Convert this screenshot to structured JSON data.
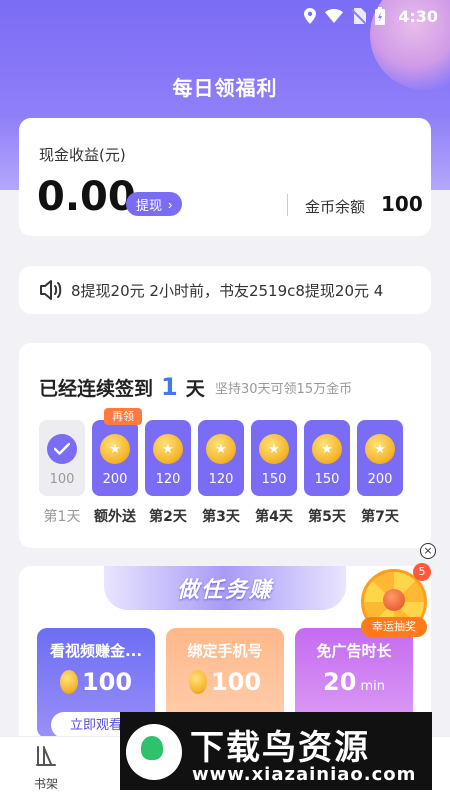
{
  "status_bar": {
    "time": "4:30"
  },
  "page": {
    "title": "每日领福利"
  },
  "earnings": {
    "label": "现金收益(元)",
    "value": "0.00",
    "withdraw_label": "提现",
    "coin_label": "金币余额",
    "coin_value": "100"
  },
  "notice": {
    "text": "8提现20元  2小时前，书友2519c8提现20元  4"
  },
  "signin": {
    "title": "已经连续签到",
    "days": "1",
    "unit": "天",
    "subtitle": "坚持30天可领15万金币",
    "tag": "再领",
    "items": [
      {
        "amount": "100",
        "label": "第1天"
      },
      {
        "amount": "200",
        "label": "额外送"
      },
      {
        "amount": "120",
        "label": "第2天"
      },
      {
        "amount": "120",
        "label": "第3天"
      },
      {
        "amount": "150",
        "label": "第4天"
      },
      {
        "amount": "150",
        "label": "第5天"
      },
      {
        "amount": "200",
        "label": "第7天"
      }
    ]
  },
  "tasks": {
    "banner": "做任务赚",
    "items": [
      {
        "name": "看视频赚金...",
        "reward": "100",
        "button": "立即观看"
      },
      {
        "name": "绑定手机号",
        "reward": "100",
        "button": ""
      },
      {
        "name": "免广告时长",
        "reward": "20",
        "unit": "min",
        "button": ""
      }
    ]
  },
  "lucky": {
    "badge": "5",
    "label": "幸运抽奖",
    "close": "×"
  },
  "tabbar": {
    "shelf_label": "书架"
  },
  "watermark": {
    "title": "下载鸟资源",
    "url": "www.xiazainiao.com"
  }
}
